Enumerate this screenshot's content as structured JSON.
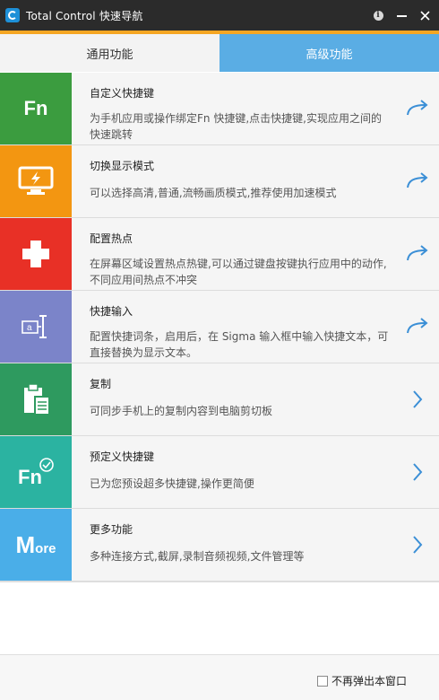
{
  "window": {
    "title": "Total Control 快速导航"
  },
  "tabs": [
    {
      "label": "通用功能"
    },
    {
      "label": "高级功能"
    }
  ],
  "items": [
    {
      "title": "自定义快捷键",
      "desc": "为手机应用或操作绑定Fn 快捷键,点击快捷键,实现应用之间的快速跳转",
      "tile_color": "#3b9c3f",
      "icon": "fn-icon",
      "action": "jump-arrow-icon"
    },
    {
      "title": "切换显示模式",
      "desc": "可以选择高清,普通,流畅画质模式,推荐使用加速模式",
      "tile_color": "#f39611",
      "icon": "monitor-icon",
      "action": "jump-arrow-icon"
    },
    {
      "title": "配置热点",
      "desc": "在屏幕区域设置热点热键,可以通过键盘按键执行应用中的动作,不同应用间热点不冲突",
      "tile_color": "#e83026",
      "icon": "plus-cross-icon",
      "action": "jump-arrow-icon"
    },
    {
      "title": "快捷输入",
      "desc": "配置快捷词条，启用后，在 Sigma 输入框中输入快捷文本，可直接替换为显示文本。",
      "tile_color": "#7b84c9",
      "icon": "text-input-icon",
      "action": "jump-arrow-icon"
    },
    {
      "title": "复制",
      "desc": "可同步手机上的复制内容到电脑剪切板",
      "tile_color": "#2e9a5f",
      "icon": "clipboard-icon",
      "action": "chevron-right-icon"
    },
    {
      "title": "预定义快捷键",
      "desc": "已为您预设超多快捷键,操作更简便",
      "tile_color": "#2bb3a1",
      "icon": "fn-check-icon",
      "action": "chevron-right-icon"
    },
    {
      "title": "更多功能",
      "desc": "多种连接方式,截屏,录制音频视频,文件管理等",
      "tile_color": "#4aaee8",
      "icon": "more-icon",
      "action": "chevron-right-icon"
    }
  ],
  "tile_labels": {
    "fn": "Fn",
    "more_big": "M",
    "more_small": "ore",
    "input_a": "a"
  },
  "footer": {
    "checkbox_label": "不再弹出本窗口",
    "checked": false
  },
  "colors": {
    "accent": "#f5a623",
    "tab_blue": "#5aade4",
    "arrow_blue": "#3b8fd6"
  }
}
